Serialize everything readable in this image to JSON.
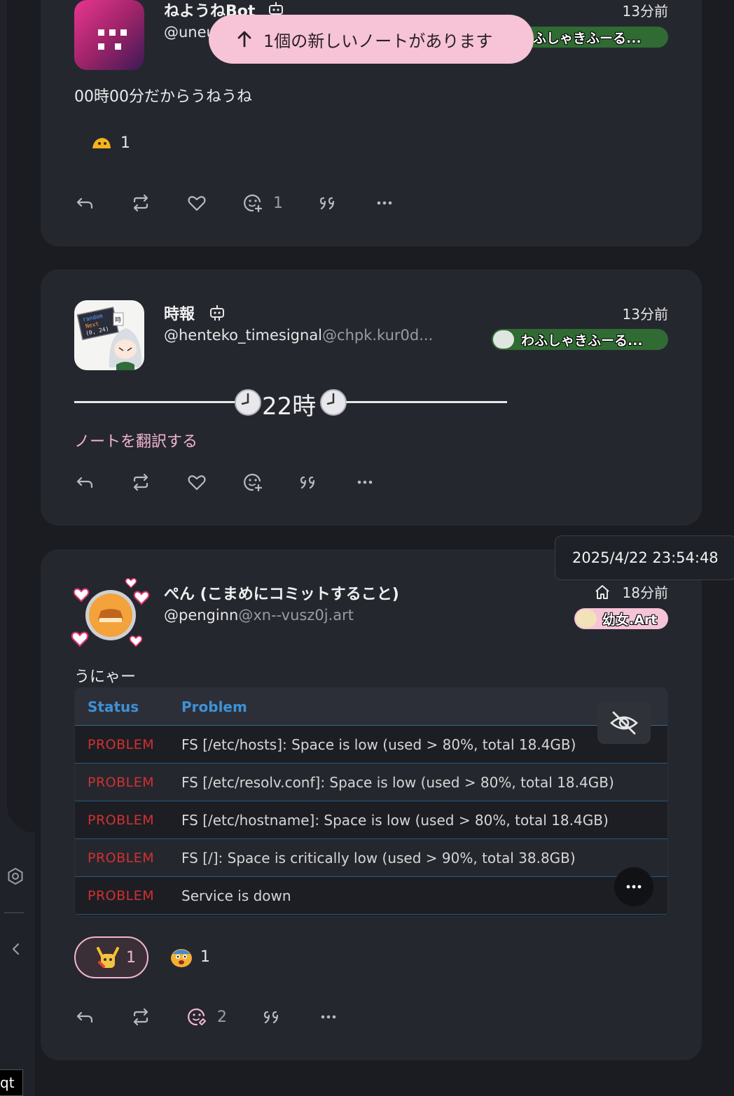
{
  "banner": {
    "label": "1個の新しいノートがあります"
  },
  "sidebar": {
    "qt_label": "qt"
  },
  "notes": [
    {
      "user_name": "ねようねBot",
      "user_handle": "@uneu",
      "time": "13分前",
      "instance": "わふしゃきふーる...",
      "text": "00時00分だからうねうね",
      "reaction_count": "1",
      "reply_count": "1"
    },
    {
      "user_name": "時報",
      "user_handle": "@henteko_timesignal",
      "user_host": "@chpk.kur0d...",
      "time": "13分前",
      "instance": "わふしゃきふーる...",
      "avatar_text": [
        "random",
        "Next",
        "(0, 24)",
        "時"
      ],
      "text_center": "22時",
      "translate_link": "ノートを翻訳する"
    },
    {
      "user_name": "ぺん (こまめにコミットすること)",
      "user_handle": "@penginn",
      "user_host": "@xn--vusz0j.art",
      "time": "18分前",
      "instance": "幼女.Art",
      "tooltip": "2025/4/22 23:54:48",
      "text": "うにゃー",
      "table": {
        "headers": [
          "Status",
          "Problem"
        ],
        "rows": [
          [
            "PROBLEM",
            "FS [/etc/hosts]: Space is low (used > 80%, total 18.4GB)"
          ],
          [
            "PROBLEM",
            "FS [/etc/resolv.conf]: Space is low (used > 80%, total 18.4GB)"
          ],
          [
            "PROBLEM",
            "FS [/etc/hostname]: Space is low (used > 80%, total 18.4GB)"
          ],
          [
            "PROBLEM",
            "FS [/]: Space is critically low (used > 90%, total 38.8GB)"
          ],
          [
            "PROBLEM",
            "Service is down"
          ]
        ]
      },
      "reactions": [
        {
          "emoji": "custom-emoji",
          "count": "1"
        },
        {
          "emoji": "custom-emoji",
          "count": "1"
        }
      ],
      "reply_count": "2"
    }
  ],
  "colors": {
    "accent": "#f1b6cf",
    "card": "#25272f",
    "bg": "#1a1c22",
    "instance_badge": "#2f6b32",
    "problem": "#d23030"
  }
}
